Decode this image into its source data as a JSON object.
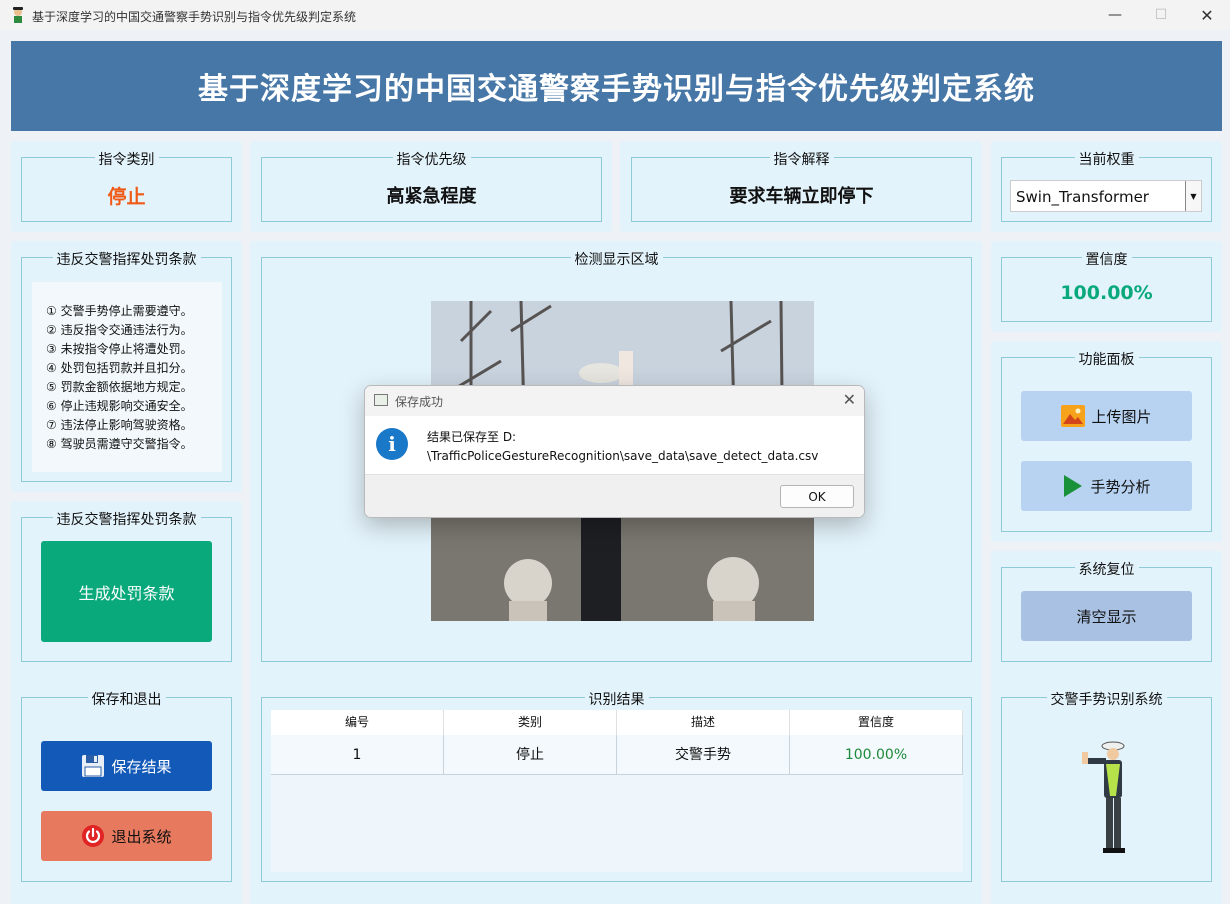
{
  "window": {
    "title": "基于深度学习的中国交通警察手势识别与指令优先级判定系统",
    "controls": {
      "minimize": "—",
      "maximize": "☐",
      "close": "✕"
    }
  },
  "banner": {
    "title": "基于深度学习的中国交通警察手势识别与指令优先级判定系统"
  },
  "instruction_type": {
    "label": "指令类别",
    "value": "停止",
    "color": "#f05a17"
  },
  "instruction_priority": {
    "label": "指令优先级",
    "value": "高紧急程度"
  },
  "instruction_explain": {
    "label": "指令解释",
    "value": "要求车辆立即停下"
  },
  "weights": {
    "label": "当前权重",
    "selected": "Swin_Transformer"
  },
  "rules": {
    "label": "违反交警指挥处罚条款",
    "items": [
      "① 交警手势停止需要遵守。",
      "② 违反指令交通违法行为。",
      "③ 未按指令停止将遭处罚。",
      "④ 处罚包括罚款并且扣分。",
      "⑤ 罚款金额依据地方规定。",
      "⑥ 停止违规影响交通安全。",
      "⑦ 违法停止影响驾驶资格。",
      "⑧ 驾驶员需遵守交警指令。"
    ]
  },
  "generate": {
    "label": "违反交警指挥处罚条款",
    "button": "生成处罚条款"
  },
  "save_exit": {
    "label": "保存和退出",
    "save_button": "保存结果",
    "exit_button": "退出系统"
  },
  "detect": {
    "label": "检测显示区域"
  },
  "confidence": {
    "label": "置信度",
    "value": "100.00%",
    "color": "#0aa97c"
  },
  "functions": {
    "label": "功能面板",
    "upload_button": "上传图片",
    "analyze_button": "手势分析"
  },
  "reset": {
    "label": "系统复位",
    "clear_button": "清空显示"
  },
  "logo": {
    "label": "交警手势识别系统"
  },
  "results": {
    "label": "识别结果",
    "columns": [
      "编号",
      "类别",
      "描述",
      "置信度"
    ],
    "rows": [
      [
        "1",
        "停止",
        "交警手势",
        "100.00%"
      ]
    ]
  },
  "dialog": {
    "title": "保存成功",
    "line1": "结果已保存至 D:",
    "line2": "\\TrafficPoliceGestureRecognition\\save_data\\save_detect_data.csv",
    "ok": "OK",
    "close": "✕"
  },
  "icons": {
    "app": "traffic-police-icon",
    "info": "information-icon",
    "save": "floppy-disk-icon",
    "exit": "power-icon",
    "upload": "image-icon",
    "analyze": "play-icon"
  }
}
